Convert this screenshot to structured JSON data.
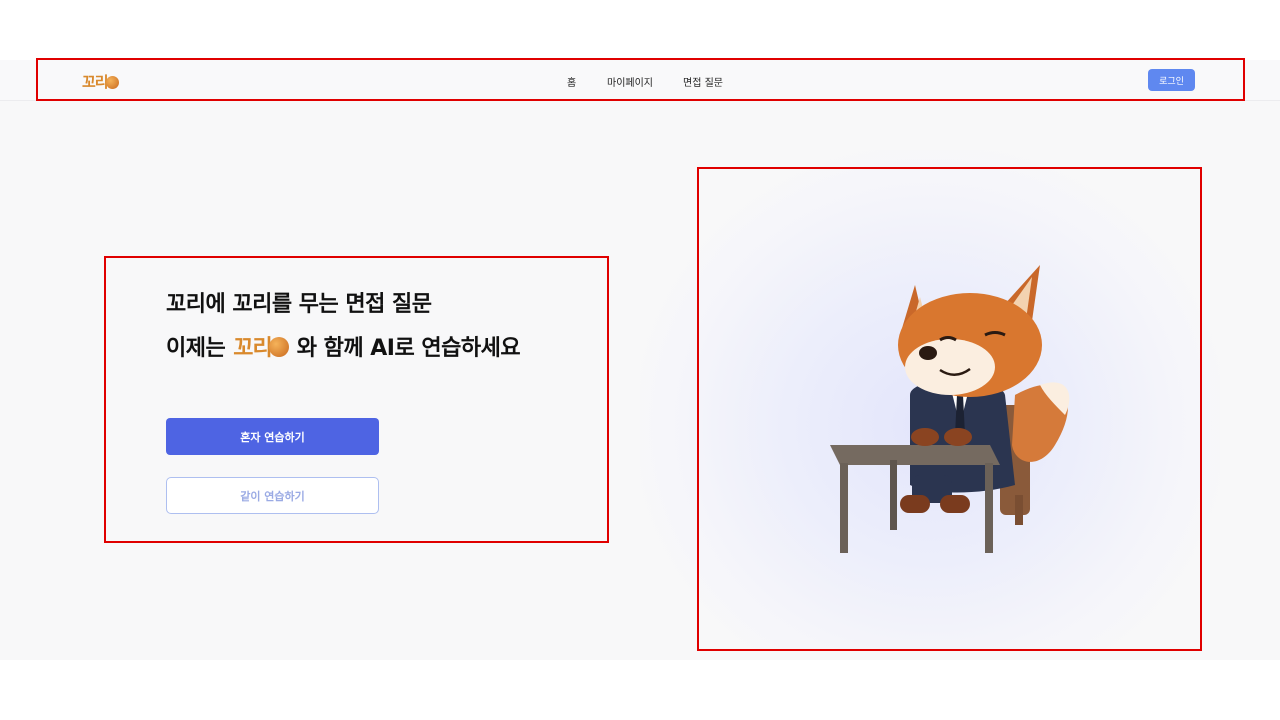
{
  "navbar": {
    "logo_text": "꼬리",
    "menu": [
      {
        "label": "홈"
      },
      {
        "label": "마이페이지"
      },
      {
        "label": "면접 질문"
      }
    ],
    "login_label": "로그인"
  },
  "hero": {
    "line1": "꼬리에 꼬리를 무는 면접 질문",
    "line2_before": "이제는",
    "line2_logo": "꼬리",
    "line2_after": "와 함께 AI로 연습하세요",
    "solo_button": "혼자 연습하기",
    "together_button": "같이 연습하기"
  },
  "illustration": {
    "subject": "fox-in-suit-at-desk"
  },
  "colors": {
    "primary": "#4e64e3",
    "login": "#5f88f0",
    "logo": "#d9892c",
    "highlight_box": "#e00000"
  }
}
